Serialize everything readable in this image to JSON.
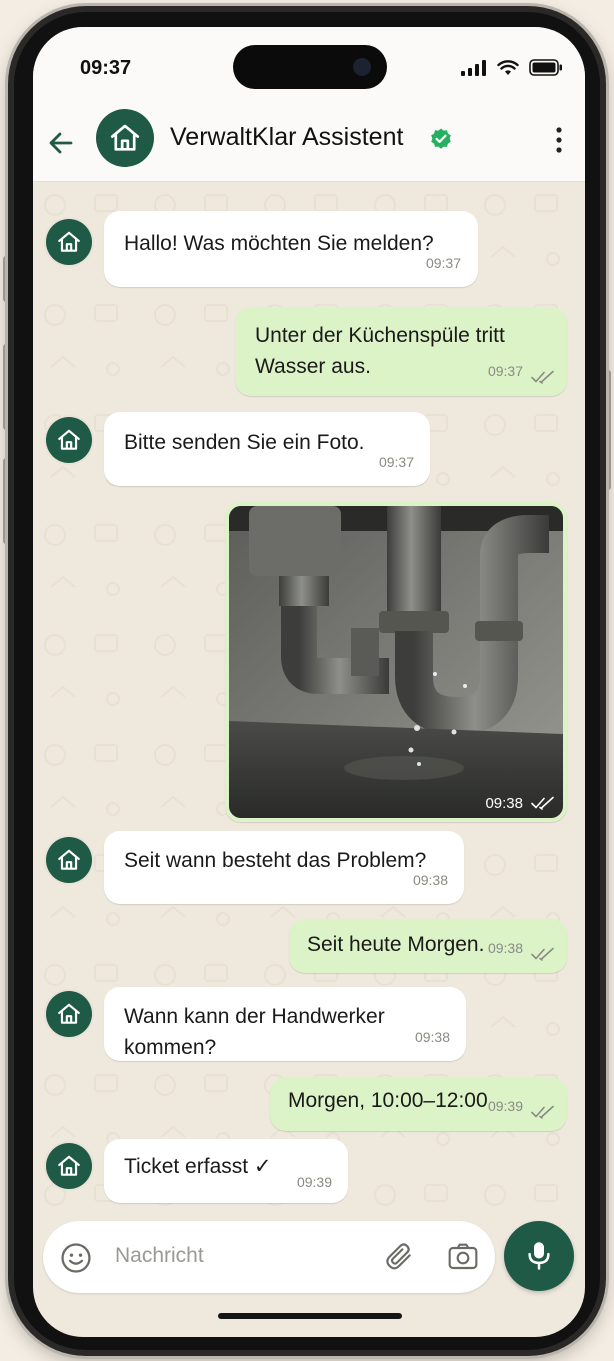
{
  "status": {
    "time": "09:37"
  },
  "header": {
    "title": "VerwaltKlar Assistent",
    "avatar_icon": "home-icon",
    "verified_icon": "verified-check-icon"
  },
  "messages": [
    {
      "from": "bot",
      "text": "Hallo! Was möchten Sie melden?",
      "time": "09:37"
    },
    {
      "from": "user",
      "text": "Unter der Küchenspüle tritt\nWasser aus.",
      "time": "09:37",
      "read": true
    },
    {
      "from": "bot",
      "text": "Bitte senden Sie ein Foto.",
      "time": "09:37"
    },
    {
      "from": "user",
      "type": "photo",
      "subject": "leaking pipe under kitchen sink",
      "time": "09:38",
      "read": true
    },
    {
      "from": "bot",
      "text": "Seit wann besteht das Problem?",
      "time": "09:38"
    },
    {
      "from": "user",
      "text": "Seit heute Morgen.",
      "time": "09:38",
      "read": true
    },
    {
      "from": "bot",
      "text": "Wann kann der Handwerker kommen?",
      "time": "09:38"
    },
    {
      "from": "user",
      "text": "Morgen, 10:00–12:00",
      "time": "09:39",
      "read": true
    },
    {
      "from": "bot",
      "text": "Ticket erfasst ✓",
      "time": "09:39"
    }
  ],
  "composer": {
    "placeholder": "Nachricht"
  },
  "colors": {
    "brand": "#1e5a45",
    "outgoing_bubble": "#dcf3c8",
    "incoming_bubble": "#ffffff",
    "verified": "#25b05f"
  }
}
